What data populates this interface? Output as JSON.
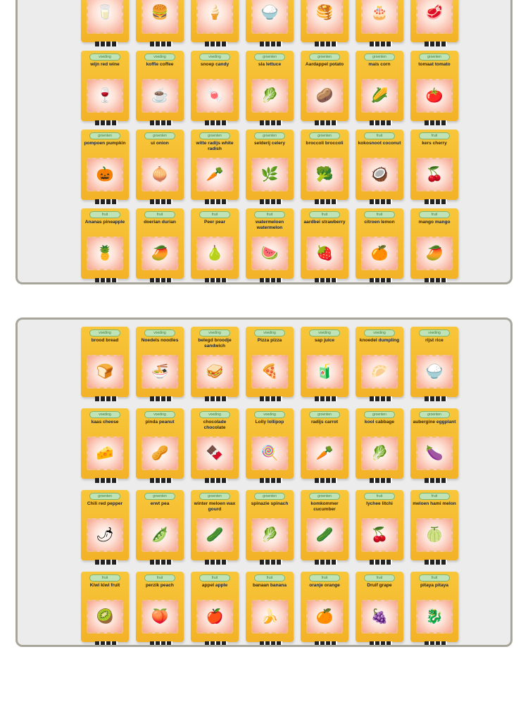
{
  "boards": [
    {
      "rows": [
        [
          {
            "cat": "",
            "word": "",
            "icon": "🥛"
          },
          {
            "cat": "",
            "word": "",
            "icon": "🍔"
          },
          {
            "cat": "",
            "word": "",
            "icon": "🍦"
          },
          {
            "cat": "",
            "word": "",
            "icon": "🍚"
          },
          {
            "cat": "",
            "word": "",
            "icon": "🥞"
          },
          {
            "cat": "",
            "word": "",
            "icon": "🎂"
          },
          {
            "cat": "",
            "word": "",
            "icon": "🥩"
          }
        ],
        [
          {
            "cat": "voeding",
            "word": "wijn red wine",
            "icon": "🍷"
          },
          {
            "cat": "voeding",
            "word": "koffie coffee",
            "icon": "☕"
          },
          {
            "cat": "voeding",
            "word": "snoep candy",
            "icon": "🍬"
          },
          {
            "cat": "groenten",
            "word": "sla lettuce",
            "icon": "🥬"
          },
          {
            "cat": "groenten",
            "word": "Aardappel potato",
            "icon": "🥔"
          },
          {
            "cat": "groenten",
            "word": "mais corn",
            "icon": "🌽"
          },
          {
            "cat": "groenten",
            "word": "tomaat tomato",
            "icon": "🍅"
          }
        ],
        [
          {
            "cat": "groenten",
            "word": "pompoen pumpkin",
            "icon": "🎃"
          },
          {
            "cat": "groenten",
            "word": "ui onion",
            "icon": "🧅"
          },
          {
            "cat": "groenten",
            "word": "witte radijs white radish",
            "icon": "🥕"
          },
          {
            "cat": "groenten",
            "word": "selderij celery",
            "icon": "🌿"
          },
          {
            "cat": "groenten",
            "word": "broccoli broccoli",
            "icon": "🥦"
          },
          {
            "cat": "fruit",
            "word": "kokosnoot coconut",
            "icon": "🥥"
          },
          {
            "cat": "fruit",
            "word": "kers cherry",
            "icon": "🍒"
          }
        ],
        [
          {
            "cat": "fruit",
            "word": "Ananas pineapple",
            "icon": "🍍"
          },
          {
            "cat": "fruit",
            "word": "doerian durian",
            "icon": "🥭"
          },
          {
            "cat": "fruit",
            "word": "Peer pear",
            "icon": "🍐"
          },
          {
            "cat": "fruit",
            "word": "watermeloen watermelon",
            "icon": "🍉"
          },
          {
            "cat": "fruit",
            "word": "aardbei strawberry",
            "icon": "🍓"
          },
          {
            "cat": "fruit",
            "word": "citroen lemon",
            "icon": "🍊"
          },
          {
            "cat": "fruit",
            "word": "mango mango",
            "icon": "🥭"
          }
        ]
      ]
    },
    {
      "rows": [
        [
          {
            "cat": "voeding",
            "word": "brood bread",
            "icon": "🍞"
          },
          {
            "cat": "voeding",
            "word": "Noedels noodles",
            "icon": "🍜"
          },
          {
            "cat": "voeding",
            "word": "belegd broodje sandwich",
            "icon": "🥪"
          },
          {
            "cat": "voeding",
            "word": "Pizza pizza",
            "icon": "🍕"
          },
          {
            "cat": "voeding",
            "word": "sap juice",
            "icon": "🧃"
          },
          {
            "cat": "voeding",
            "word": "knoedel dumpling",
            "icon": "🥟"
          },
          {
            "cat": "voeding",
            "word": "rijst rice",
            "icon": "🍚"
          }
        ],
        [
          {
            "cat": "voeding",
            "word": "kaas cheese",
            "icon": "🧀"
          },
          {
            "cat": "voeding",
            "word": "pinda peanut",
            "icon": "🥜"
          },
          {
            "cat": "voeding",
            "word": "chocolade chocolate",
            "icon": "🍫"
          },
          {
            "cat": "voeding",
            "word": "Lolly lollipop",
            "icon": "🍭"
          },
          {
            "cat": "groenten",
            "word": "radijs carrot",
            "icon": "🥕"
          },
          {
            "cat": "groenten",
            "word": "kool cabbage",
            "icon": "🥬"
          },
          {
            "cat": "groenten",
            "word": "aubergine eggplant",
            "icon": "🍆"
          }
        ],
        [
          {
            "cat": "groenten",
            "word": "Chili red pepper",
            "icon": "🌶"
          },
          {
            "cat": "groenten",
            "word": "erwt pea",
            "icon": "🫛"
          },
          {
            "cat": "groenten",
            "word": "winter meloen wax gourd",
            "icon": "🥒"
          },
          {
            "cat": "groenten",
            "word": "spinazie spinach",
            "icon": "🥬"
          },
          {
            "cat": "groenten",
            "word": "komkommer cucumber",
            "icon": "🥒"
          },
          {
            "cat": "fruit",
            "word": "lychee litchi",
            "icon": "🍒"
          },
          {
            "cat": "fruit",
            "word": "meloen hami melon",
            "icon": "🍈"
          }
        ],
        [
          {
            "cat": "fruit",
            "word": "Kiwi kiwi fruit",
            "icon": "🥝"
          },
          {
            "cat": "fruit",
            "word": "perzik peach",
            "icon": "🍑"
          },
          {
            "cat": "fruit",
            "word": "appel apple",
            "icon": "🍎"
          },
          {
            "cat": "fruit",
            "word": "banaan banana",
            "icon": "🍌"
          },
          {
            "cat": "fruit",
            "word": "oranje orange",
            "icon": "🍊"
          },
          {
            "cat": "fruit",
            "word": "Druif grape",
            "icon": "🍇"
          },
          {
            "cat": "fruit",
            "word": "pitaya pitaya",
            "icon": "🐉"
          }
        ]
      ]
    }
  ]
}
